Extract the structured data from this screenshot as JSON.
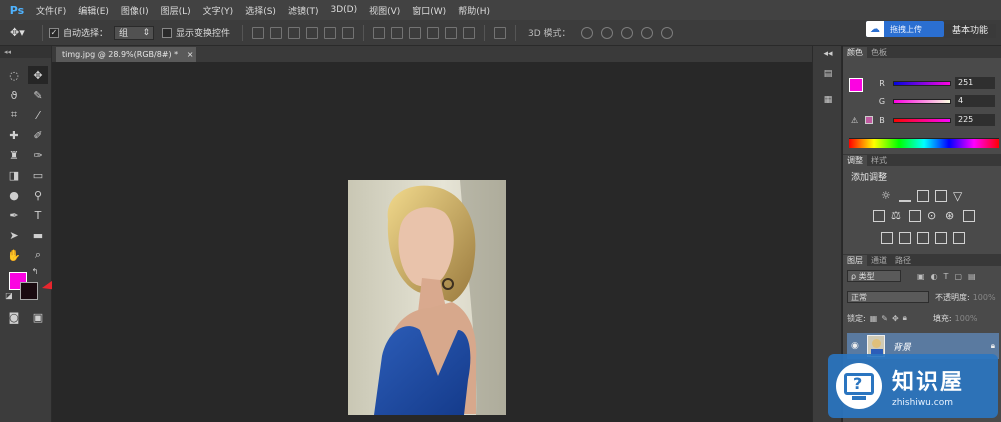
{
  "app": {
    "logo": "Ps"
  },
  "menubar": {
    "items": [
      "文件(F)",
      "编辑(E)",
      "图像(I)",
      "图层(L)",
      "文字(Y)",
      "选择(S)",
      "滤镜(T)",
      "3D(D)",
      "视图(V)",
      "窗口(W)",
      "帮助(H)"
    ]
  },
  "cloud": {
    "label": "拖拽上传"
  },
  "workspace": {
    "label": "基本功能"
  },
  "options": {
    "auto_select_label": "自动选择：",
    "auto_select_checked": true,
    "group_value": "组",
    "show_transform_label": "显示变换控件",
    "mode3d_label": "3D 模式："
  },
  "document": {
    "tab_title": "timg.jpg @ 28.9%(RGB/8#) *"
  },
  "colors": {
    "foreground": "#fb04e1",
    "background": "#1a0a10"
  },
  "color_panel": {
    "tabs": [
      "颜色",
      "色板"
    ],
    "r_label": "R",
    "g_label": "G",
    "b_label": "B",
    "r_value": "251",
    "g_value": "4",
    "b_value": "225"
  },
  "adjust_panel": {
    "tabs": [
      "调整",
      "样式"
    ],
    "heading": "添加调整"
  },
  "layers_panel": {
    "tabs": [
      "图层",
      "通道",
      "路径"
    ],
    "kind_label": "ρ 类型",
    "blend_mode": "正常",
    "opacity_label": "不透明度:",
    "opacity_value": "100%",
    "lock_label": "锁定:",
    "fill_label": "填充:",
    "fill_value": "100%",
    "layer_name": "背景"
  },
  "watermark": {
    "title": "知识屋",
    "subtitle": "zhishiwu.com"
  }
}
